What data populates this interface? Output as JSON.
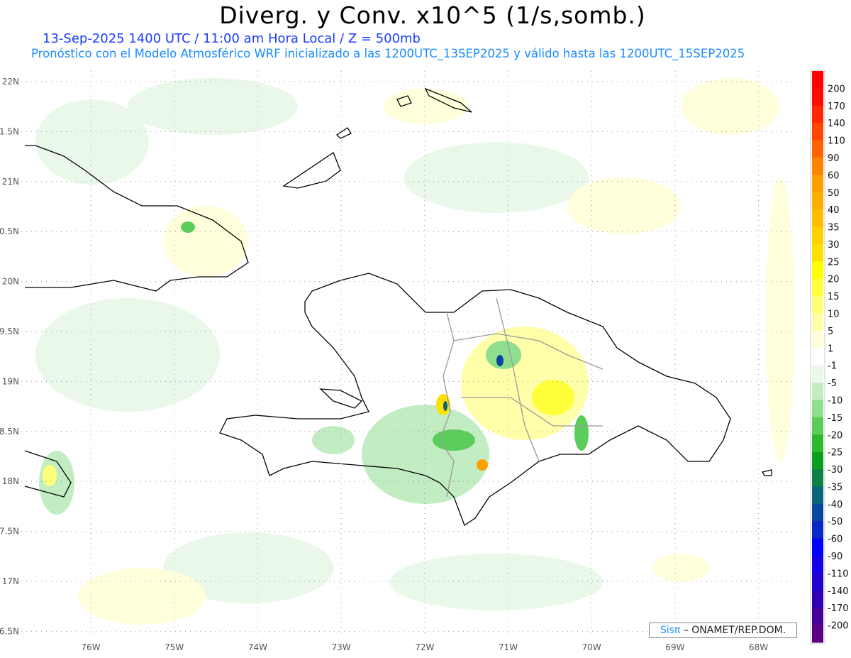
{
  "header": {
    "title": "Diverg. y Conv. x10^5 (1/s,somb.)",
    "subtitle": "13-Sep-2025 1400 UTC / 11:00 am Hora Local / Z = 500mb",
    "model_line": "Pronóstico con el Modelo Atmosférico WRF inicializado a las 1200UTC_13SEP2025 y válido hasta las  1200UTC_15SEP2025"
  },
  "axes": {
    "lon_labels": [
      "76W",
      "75W",
      "74W",
      "73W",
      "72W",
      "71W",
      "70W",
      "69W",
      "68W"
    ],
    "lat_labels": [
      "22N",
      "1.5N",
      "21N",
      "0.5N",
      "20N",
      "9.5N",
      "19N",
      "8.5N",
      "18N",
      "7.5N",
      "17N",
      "6.5N"
    ]
  },
  "colorbar": {
    "labels": [
      "200",
      "170",
      "140",
      "110",
      "90",
      "60",
      "50",
      "40",
      "35",
      "30",
      "25",
      "20",
      "15",
      "10",
      "5",
      "1",
      "-1",
      "-5",
      "-10",
      "-15",
      "-20",
      "-25",
      "-30",
      "-35",
      "-40",
      "-50",
      "-60",
      "-90",
      "-110",
      "-140",
      "-170",
      "-200"
    ],
    "colors": [
      "#ff0000",
      "#ff0a00",
      "#ff2800",
      "#ff4600",
      "#ff6400",
      "#ff8200",
      "#ffa000",
      "#ffaf00",
      "#ffbe00",
      "#ffd200",
      "#ffe100",
      "#ffff00",
      "#ffff3c",
      "#ffff78",
      "#ffffaa",
      "#ffffdc",
      "#ffffff",
      "#eaf8ea",
      "#c2ecc2",
      "#8ede8e",
      "#5acd5a",
      "#2db92d",
      "#0aa01e",
      "#0a8246",
      "#0a6478",
      "#0a46a0",
      "#0a28c8",
      "#0000ff",
      "#1400e6",
      "#2300d2",
      "#3200b4",
      "#46009b",
      "#5a0082"
    ]
  },
  "credit": {
    "logo": "Sisπ",
    "text": "– ONAMET/REP.DOM."
  }
}
